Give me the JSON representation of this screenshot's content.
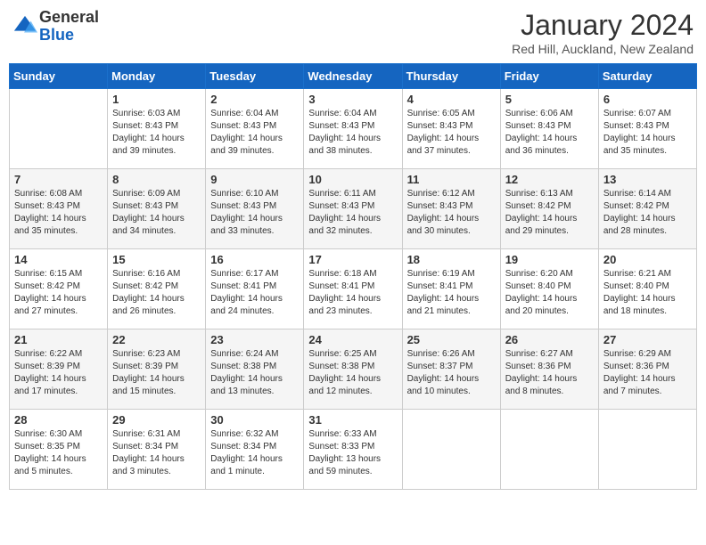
{
  "header": {
    "logo_general": "General",
    "logo_blue": "Blue",
    "title": "January 2024",
    "location": "Red Hill, Auckland, New Zealand"
  },
  "weekdays": [
    "Sunday",
    "Monday",
    "Tuesday",
    "Wednesday",
    "Thursday",
    "Friday",
    "Saturday"
  ],
  "weeks": [
    [
      {
        "day": "",
        "info": ""
      },
      {
        "day": "1",
        "info": "Sunrise: 6:03 AM\nSunset: 8:43 PM\nDaylight: 14 hours\nand 39 minutes."
      },
      {
        "day": "2",
        "info": "Sunrise: 6:04 AM\nSunset: 8:43 PM\nDaylight: 14 hours\nand 39 minutes."
      },
      {
        "day": "3",
        "info": "Sunrise: 6:04 AM\nSunset: 8:43 PM\nDaylight: 14 hours\nand 38 minutes."
      },
      {
        "day": "4",
        "info": "Sunrise: 6:05 AM\nSunset: 8:43 PM\nDaylight: 14 hours\nand 37 minutes."
      },
      {
        "day": "5",
        "info": "Sunrise: 6:06 AM\nSunset: 8:43 PM\nDaylight: 14 hours\nand 36 minutes."
      },
      {
        "day": "6",
        "info": "Sunrise: 6:07 AM\nSunset: 8:43 PM\nDaylight: 14 hours\nand 35 minutes."
      }
    ],
    [
      {
        "day": "7",
        "info": "Sunrise: 6:08 AM\nSunset: 8:43 PM\nDaylight: 14 hours\nand 35 minutes."
      },
      {
        "day": "8",
        "info": "Sunrise: 6:09 AM\nSunset: 8:43 PM\nDaylight: 14 hours\nand 34 minutes."
      },
      {
        "day": "9",
        "info": "Sunrise: 6:10 AM\nSunset: 8:43 PM\nDaylight: 14 hours\nand 33 minutes."
      },
      {
        "day": "10",
        "info": "Sunrise: 6:11 AM\nSunset: 8:43 PM\nDaylight: 14 hours\nand 32 minutes."
      },
      {
        "day": "11",
        "info": "Sunrise: 6:12 AM\nSunset: 8:43 PM\nDaylight: 14 hours\nand 30 minutes."
      },
      {
        "day": "12",
        "info": "Sunrise: 6:13 AM\nSunset: 8:42 PM\nDaylight: 14 hours\nand 29 minutes."
      },
      {
        "day": "13",
        "info": "Sunrise: 6:14 AM\nSunset: 8:42 PM\nDaylight: 14 hours\nand 28 minutes."
      }
    ],
    [
      {
        "day": "14",
        "info": "Sunrise: 6:15 AM\nSunset: 8:42 PM\nDaylight: 14 hours\nand 27 minutes."
      },
      {
        "day": "15",
        "info": "Sunrise: 6:16 AM\nSunset: 8:42 PM\nDaylight: 14 hours\nand 26 minutes."
      },
      {
        "day": "16",
        "info": "Sunrise: 6:17 AM\nSunset: 8:41 PM\nDaylight: 14 hours\nand 24 minutes."
      },
      {
        "day": "17",
        "info": "Sunrise: 6:18 AM\nSunset: 8:41 PM\nDaylight: 14 hours\nand 23 minutes."
      },
      {
        "day": "18",
        "info": "Sunrise: 6:19 AM\nSunset: 8:41 PM\nDaylight: 14 hours\nand 21 minutes."
      },
      {
        "day": "19",
        "info": "Sunrise: 6:20 AM\nSunset: 8:40 PM\nDaylight: 14 hours\nand 20 minutes."
      },
      {
        "day": "20",
        "info": "Sunrise: 6:21 AM\nSunset: 8:40 PM\nDaylight: 14 hours\nand 18 minutes."
      }
    ],
    [
      {
        "day": "21",
        "info": "Sunrise: 6:22 AM\nSunset: 8:39 PM\nDaylight: 14 hours\nand 17 minutes."
      },
      {
        "day": "22",
        "info": "Sunrise: 6:23 AM\nSunset: 8:39 PM\nDaylight: 14 hours\nand 15 minutes."
      },
      {
        "day": "23",
        "info": "Sunrise: 6:24 AM\nSunset: 8:38 PM\nDaylight: 14 hours\nand 13 minutes."
      },
      {
        "day": "24",
        "info": "Sunrise: 6:25 AM\nSunset: 8:38 PM\nDaylight: 14 hours\nand 12 minutes."
      },
      {
        "day": "25",
        "info": "Sunrise: 6:26 AM\nSunset: 8:37 PM\nDaylight: 14 hours\nand 10 minutes."
      },
      {
        "day": "26",
        "info": "Sunrise: 6:27 AM\nSunset: 8:36 PM\nDaylight: 14 hours\nand 8 minutes."
      },
      {
        "day": "27",
        "info": "Sunrise: 6:29 AM\nSunset: 8:36 PM\nDaylight: 14 hours\nand 7 minutes."
      }
    ],
    [
      {
        "day": "28",
        "info": "Sunrise: 6:30 AM\nSunset: 8:35 PM\nDaylight: 14 hours\nand 5 minutes."
      },
      {
        "day": "29",
        "info": "Sunrise: 6:31 AM\nSunset: 8:34 PM\nDaylight: 14 hours\nand 3 minutes."
      },
      {
        "day": "30",
        "info": "Sunrise: 6:32 AM\nSunset: 8:34 PM\nDaylight: 14 hours\nand 1 minute."
      },
      {
        "day": "31",
        "info": "Sunrise: 6:33 AM\nSunset: 8:33 PM\nDaylight: 13 hours\nand 59 minutes."
      },
      {
        "day": "",
        "info": ""
      },
      {
        "day": "",
        "info": ""
      },
      {
        "day": "",
        "info": ""
      }
    ]
  ]
}
